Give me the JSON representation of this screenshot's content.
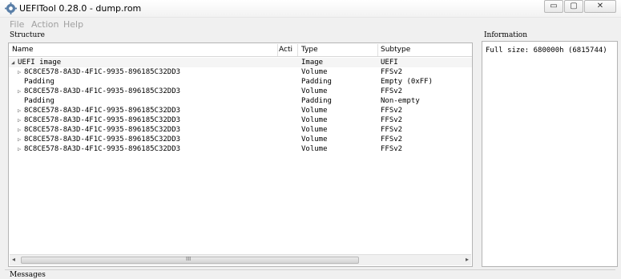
{
  "window": {
    "title": "UEFITool 0.28.0 - dump.rom",
    "minimize_glyph": "▭",
    "maximize_glyph": "▢",
    "close_glyph": "✕"
  },
  "menu": {
    "file": "File",
    "action": "Action",
    "help": "Help"
  },
  "structure": {
    "label": "Structure",
    "columns": {
      "name": "Name",
      "action": "Acti",
      "type": "Type",
      "subtype": "Subtype"
    },
    "rows": [
      {
        "expander": "◢",
        "name": "UEFI image",
        "action": "",
        "type": "Image",
        "subtype": "UEFI"
      },
      {
        "expander": "▷",
        "name": "8C8CE578-8A3D-4F1C-9935-896185C32DD3",
        "action": "",
        "type": "Volume",
        "subtype": "FFSv2"
      },
      {
        "expander": "",
        "name": "Padding",
        "action": "",
        "type": "Padding",
        "subtype": "Empty (0xFF)"
      },
      {
        "expander": "▷",
        "name": "8C8CE578-8A3D-4F1C-9935-896185C32DD3",
        "action": "",
        "type": "Volume",
        "subtype": "FFSv2"
      },
      {
        "expander": "",
        "name": "Padding",
        "action": "",
        "type": "Padding",
        "subtype": "Non-empty"
      },
      {
        "expander": "▷",
        "name": "8C8CE578-8A3D-4F1C-9935-896185C32DD3",
        "action": "",
        "type": "Volume",
        "subtype": "FFSv2"
      },
      {
        "expander": "▷",
        "name": "8C8CE578-8A3D-4F1C-9935-896185C32DD3",
        "action": "",
        "type": "Volume",
        "subtype": "FFSv2"
      },
      {
        "expander": "▷",
        "name": "8C8CE578-8A3D-4F1C-9935-896185C32DD3",
        "action": "",
        "type": "Volume",
        "subtype": "FFSv2"
      },
      {
        "expander": "▷",
        "name": "8C8CE578-8A3D-4F1C-9935-896185C32DD3",
        "action": "",
        "type": "Volume",
        "subtype": "FFSv2"
      },
      {
        "expander": "▷",
        "name": "8C8CE578-8A3D-4F1C-9935-896185C32DD3",
        "action": "",
        "type": "Volume",
        "subtype": "FFSv2"
      }
    ],
    "scroll_left_glyph": "◂",
    "scroll_right_glyph": "▸",
    "scroll_grip": "III"
  },
  "information": {
    "label": "Information",
    "text": "Full size: 680000h (6815744)"
  },
  "messages": {
    "label": "Messages"
  },
  "icons": {
    "app": "gear-icon",
    "minimize": "minimize-icon",
    "maximize": "maximize-icon",
    "close": "close-icon"
  }
}
